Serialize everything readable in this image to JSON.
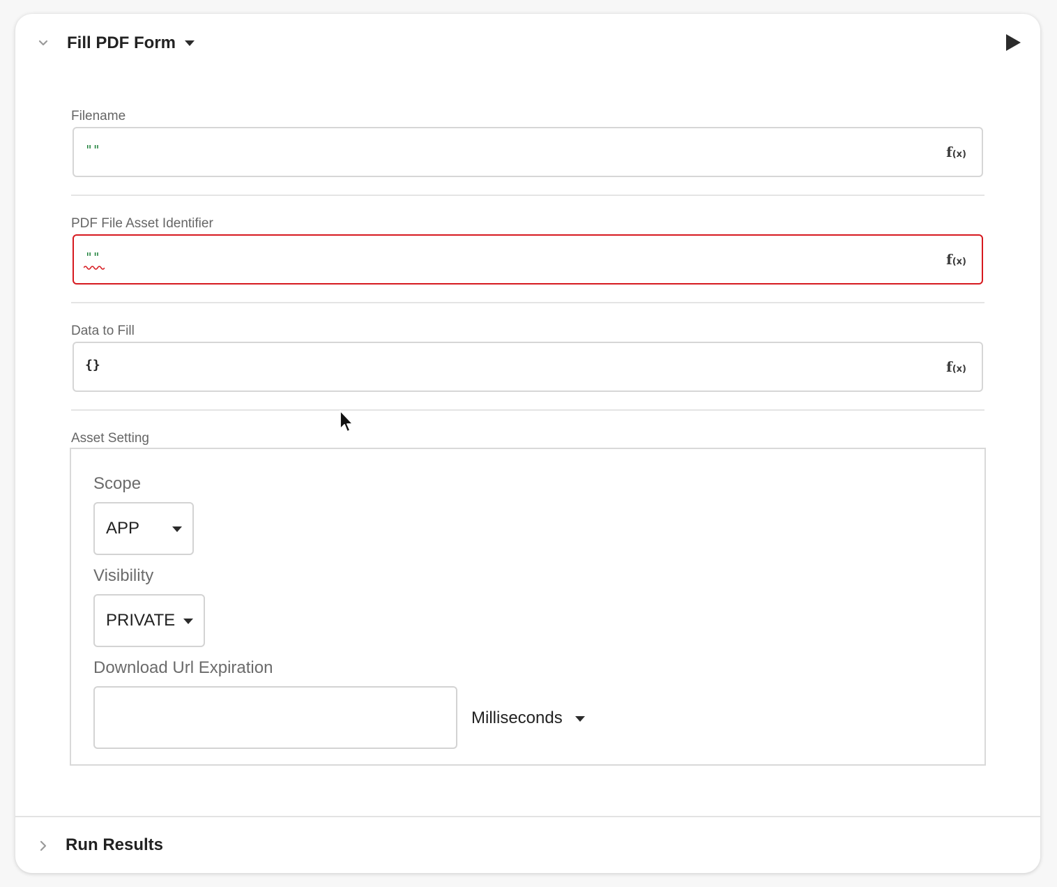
{
  "header": {
    "title": "Fill PDF Form"
  },
  "fields": [
    {
      "label": "Filename",
      "value": "\"\"",
      "fx": "f",
      "fx_sub": "(x)",
      "error": false
    },
    {
      "label": "PDF File Asset Identifier",
      "value": "\"\"",
      "fx": "f",
      "fx_sub": "(x)",
      "error": true
    },
    {
      "label": "Data to Fill",
      "value": "{}",
      "fx": "f",
      "fx_sub": "(x)",
      "error": false
    }
  ],
  "asset_setting": {
    "label": "Asset Setting",
    "scope": {
      "label": "Scope",
      "value": "APP"
    },
    "visibility": {
      "label": "Visibility",
      "value": "PRIVATE"
    },
    "download_url_expiration": {
      "label": "Download Url Expiration",
      "value": "",
      "unit": "Milliseconds"
    }
  },
  "footer": {
    "title": "Run Results"
  },
  "colors": {
    "error_border": "#d6191f",
    "string_value": "#1a7f37"
  }
}
